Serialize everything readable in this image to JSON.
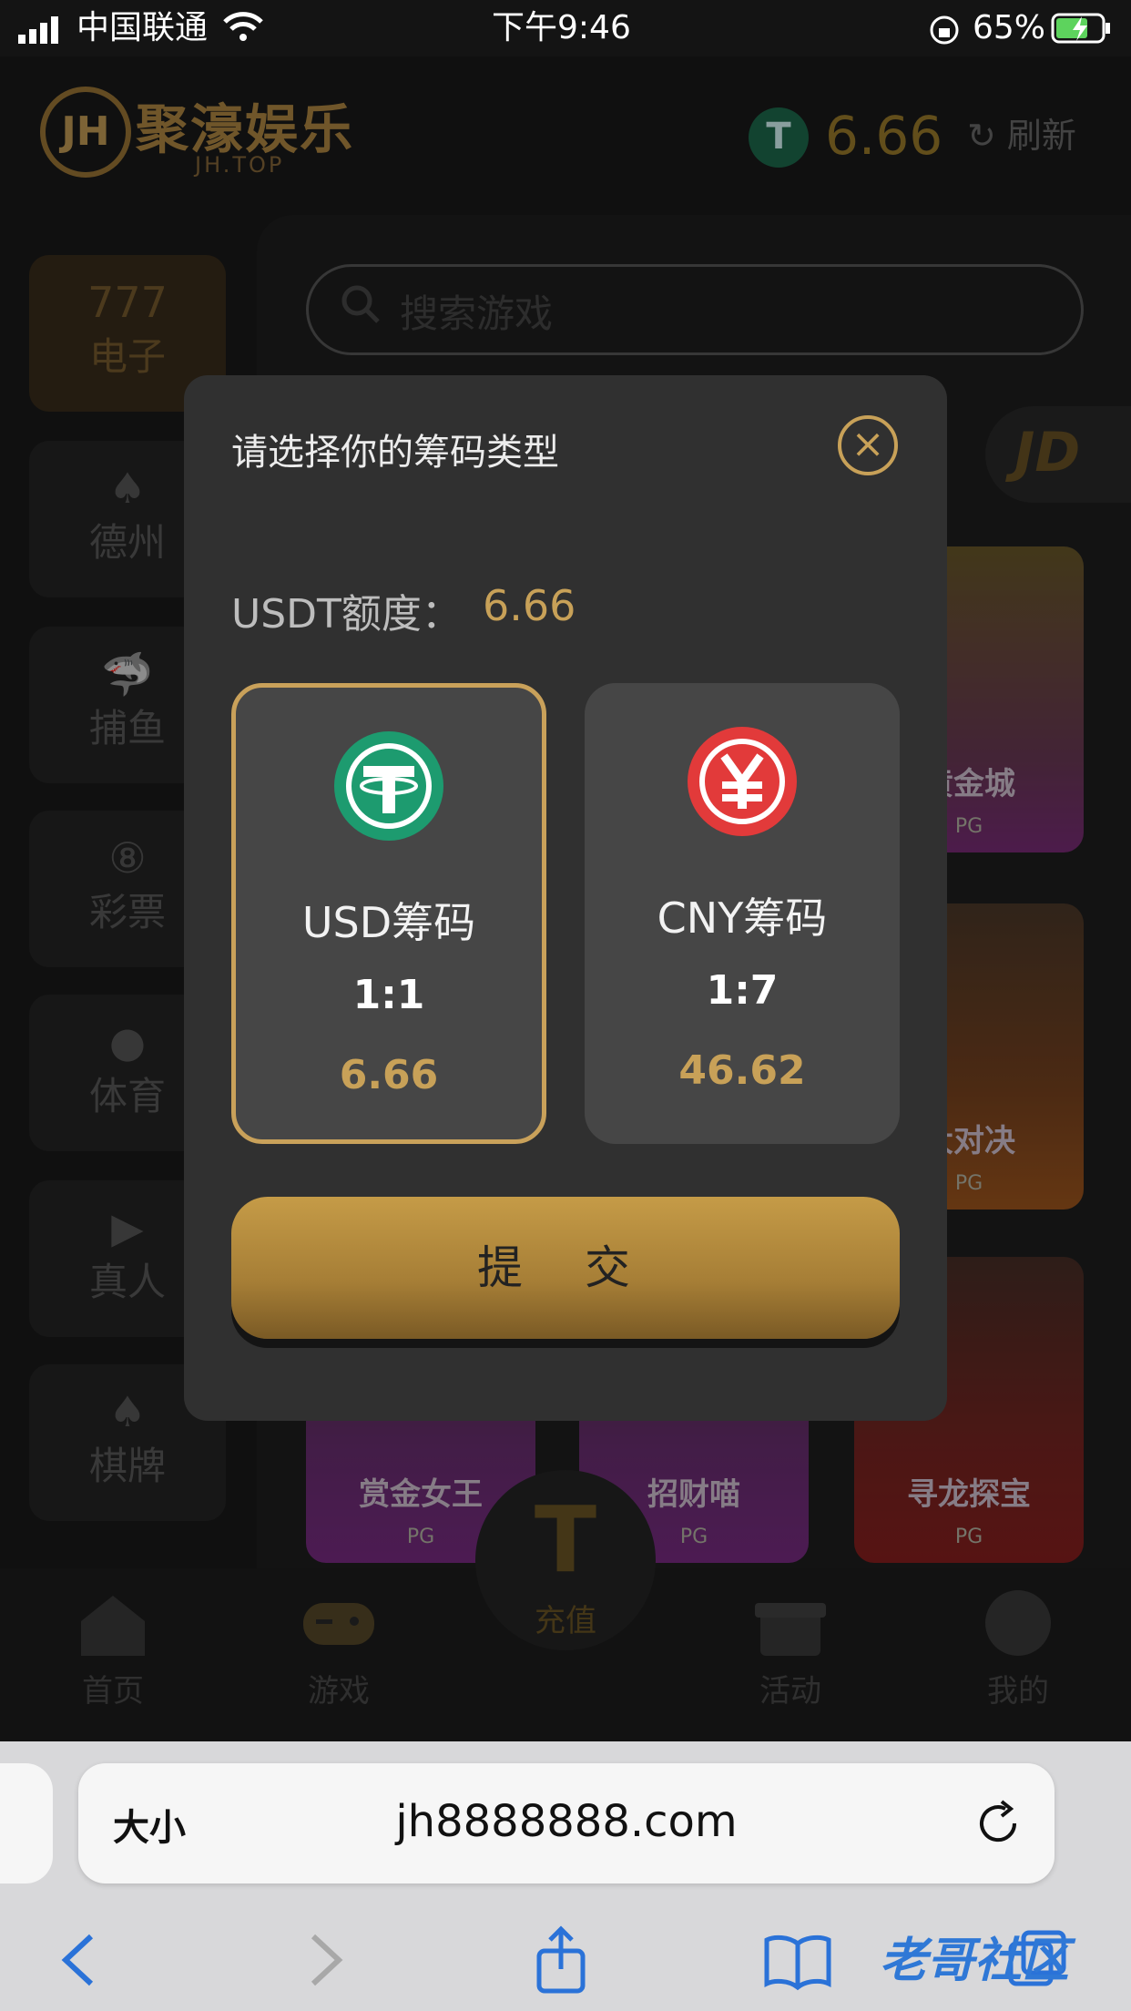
{
  "status": {
    "carrier": "中国联通",
    "time": "下午9:46",
    "battery": "65%"
  },
  "brand": {
    "name": "聚濠娱乐",
    "sub": "JH.TOP",
    "logo": "JH"
  },
  "balance": {
    "value": "6.66",
    "refresh": "刷新"
  },
  "sidebar": {
    "items": [
      {
        "label": "电子",
        "icon": "777"
      },
      {
        "label": "德州",
        "icon": "♠"
      },
      {
        "label": "捕鱼",
        "icon": "🦈"
      },
      {
        "label": "彩票",
        "icon": "⑧"
      },
      {
        "label": "体育",
        "icon": "●"
      },
      {
        "label": "真人",
        "icon": "▶"
      },
      {
        "label": "棋牌",
        "icon": "♠"
      }
    ]
  },
  "search": {
    "placeholder": "搜索游戏"
  },
  "games": [
    {
      "name": "黄金城",
      "brand": "PG"
    },
    {
      "name": "大对决",
      "brand": "PG"
    },
    {
      "name": "赏金女王",
      "brand": "PG"
    },
    {
      "name": "招财喵",
      "brand": "PG"
    },
    {
      "name": "寻龙探宝",
      "brand": "PG"
    }
  ],
  "partial_brand": "JD",
  "tabbar": {
    "home": "首页",
    "games": "游戏",
    "recharge": "充值",
    "activity": "活动",
    "mine": "我的"
  },
  "modal": {
    "title": "请选择你的筹码类型",
    "quota_label": "USDT额度：",
    "quota_value": "6.66",
    "options": [
      {
        "name": "USD筹码",
        "rate": "1:1",
        "amount": "6.66",
        "icon": "tether-icon",
        "color": "#1d9b6f"
      },
      {
        "name": "CNY筹码",
        "rate": "1:7",
        "amount": "46.62",
        "icon": "yuan-icon",
        "color": "#e23a3a"
      }
    ],
    "submit": "提 交"
  },
  "browser": {
    "text_size": "大小",
    "url": "jh8888888.com",
    "watermark": "老哥社区"
  }
}
